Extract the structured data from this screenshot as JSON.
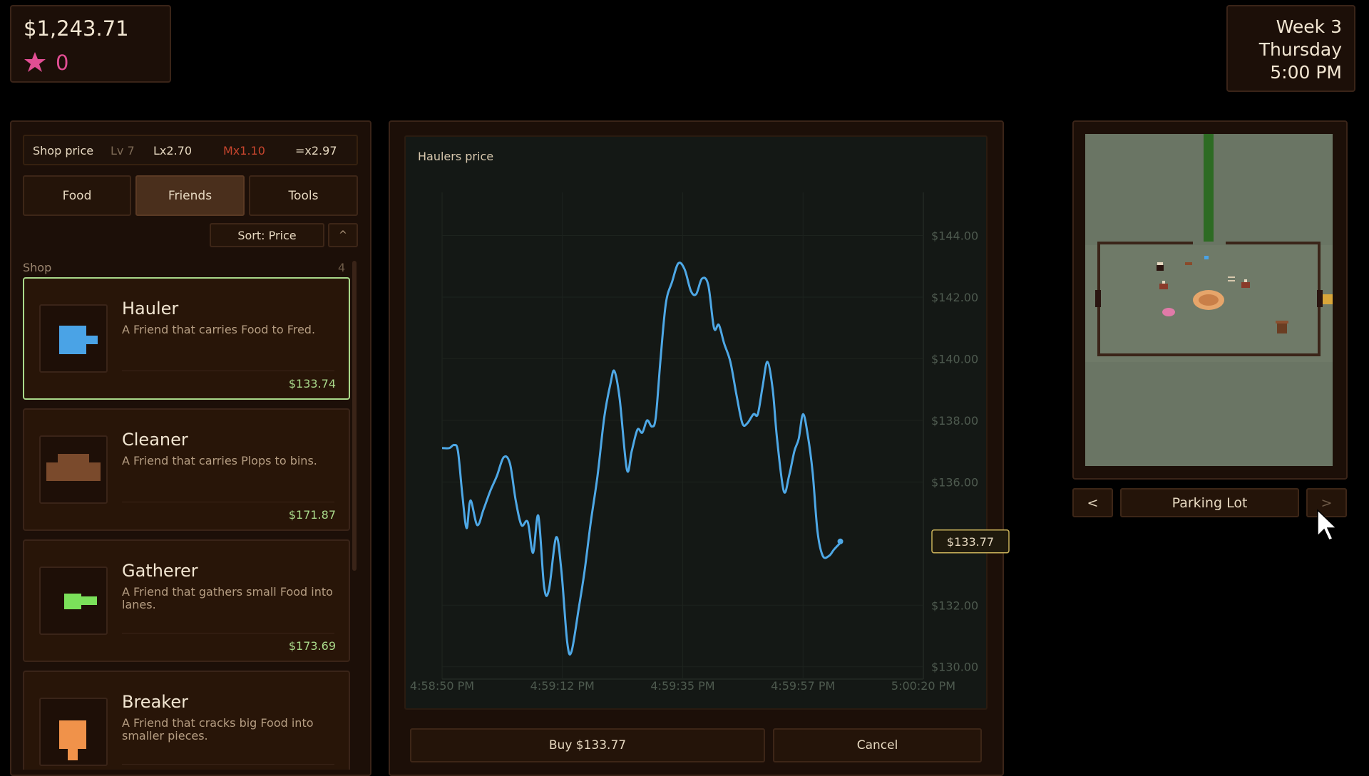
{
  "hud": {
    "money": "$1,243.71",
    "stars": "0"
  },
  "date": {
    "week": "Week 3",
    "day": "Thursday",
    "time": "5:00 PM"
  },
  "shop": {
    "price_row": {
      "label": "Shop price",
      "level": "Lv 7",
      "lx": "Lx2.70",
      "mx": "Mx1.10",
      "total": "=x2.97"
    },
    "tabs": [
      {
        "label": "Food"
      },
      {
        "label": "Friends"
      },
      {
        "label": "Tools"
      }
    ],
    "sort_label": "Sort: Price",
    "sort_dir": "^",
    "section_label": "Shop",
    "section_count": "4",
    "items": [
      {
        "name": "Hauler",
        "desc": "A Friend that carries Food to Fred.",
        "price": "$133.74",
        "icon_color": "#4aa3e6"
      },
      {
        "name": "Cleaner",
        "desc": "A Friend that carries Plops to bins.",
        "price": "$171.87",
        "icon_color": "#7a4a2c"
      },
      {
        "name": "Gatherer",
        "desc": "A Friend that gathers small Food into lanes.",
        "price": "$173.69",
        "icon_color": "#7be05a"
      },
      {
        "name": "Breaker",
        "desc": "A Friend that cracks big Food into smaller pieces.",
        "price": "",
        "icon_color": "#f0924a"
      }
    ]
  },
  "chart_title": "Haulers price",
  "buttons": {
    "buy": "Buy $133.77",
    "cancel": "Cancel"
  },
  "map": {
    "location": "Parking Lot",
    "prev": "<",
    "next": ">"
  },
  "chart_data": {
    "type": "line",
    "title": "Haulers price",
    "x_ticks": [
      "4:58:50 PM",
      "4:59:12 PM",
      "4:59:35 PM",
      "4:59:57 PM",
      "5:00:20 PM"
    ],
    "y_ticks": [
      "$144.00",
      "$142.00",
      "$140.00",
      "$138.00",
      "$136.00",
      "$132.00",
      "$130.00"
    ],
    "ylim": [
      129.6,
      145.4
    ],
    "current_label": "$133.77",
    "series": [
      {
        "color": "#4ea8e6",
        "values": [
          [
            0,
            137.1
          ],
          [
            1.5,
            137.1
          ],
          [
            2.5,
            137.2
          ],
          [
            3.3,
            137.0
          ],
          [
            4.2,
            135.6
          ],
          [
            5.1,
            134.5
          ],
          [
            5.9,
            135.4
          ],
          [
            7.3,
            134.6
          ],
          [
            8.6,
            135.1
          ],
          [
            10.0,
            135.7
          ],
          [
            11.4,
            136.2
          ],
          [
            12.8,
            136.8
          ],
          [
            14.1,
            136.6
          ],
          [
            15.3,
            135.4
          ],
          [
            16.5,
            134.6
          ],
          [
            17.8,
            134.7
          ],
          [
            18.9,
            133.7
          ],
          [
            20.0,
            134.9
          ],
          [
            21.2,
            132.6
          ],
          [
            22.2,
            132.5
          ],
          [
            23.7,
            134.2
          ],
          [
            24.8,
            133.1
          ],
          [
            26.0,
            130.8
          ],
          [
            26.9,
            130.5
          ],
          [
            28.4,
            131.9
          ],
          [
            29.6,
            133.1
          ],
          [
            30.9,
            134.7
          ],
          [
            32.3,
            136.2
          ],
          [
            33.7,
            138.1
          ],
          [
            35.0,
            139.2
          ],
          [
            35.8,
            139.6
          ],
          [
            36.9,
            138.7
          ],
          [
            38.4,
            136.4
          ],
          [
            39.4,
            137.0
          ],
          [
            40.6,
            137.7
          ],
          [
            41.6,
            137.6
          ],
          [
            42.6,
            138.0
          ],
          [
            43.6,
            137.8
          ],
          [
            44.4,
            138.1
          ],
          [
            45.4,
            140.0
          ],
          [
            46.5,
            141.8
          ],
          [
            47.8,
            142.5
          ],
          [
            49.1,
            143.1
          ],
          [
            50.4,
            142.9
          ],
          [
            51.7,
            142.2
          ],
          [
            52.8,
            142.1
          ],
          [
            54.0,
            142.6
          ],
          [
            55.3,
            142.4
          ],
          [
            56.5,
            141.0
          ],
          [
            57.5,
            141.1
          ],
          [
            58.6,
            140.5
          ],
          [
            59.9,
            139.9
          ],
          [
            61.2,
            138.8
          ],
          [
            62.4,
            137.9
          ],
          [
            63.4,
            137.9
          ],
          [
            64.7,
            138.2
          ],
          [
            65.6,
            138.2
          ],
          [
            66.6,
            139.1
          ],
          [
            67.6,
            139.9
          ],
          [
            68.7,
            139.0
          ],
          [
            69.6,
            137.4
          ],
          [
            71.0,
            135.7
          ],
          [
            72.1,
            136.2
          ],
          [
            73.2,
            137.0
          ],
          [
            74.1,
            137.4
          ],
          [
            75.0,
            138.2
          ],
          [
            76.0,
            137.5
          ],
          [
            77.0,
            136.3
          ],
          [
            78.0,
            134.4
          ],
          [
            79.1,
            133.6
          ],
          [
            80.4,
            133.6
          ],
          [
            81.4,
            133.8
          ],
          [
            82.6,
            134.0
          ]
        ]
      }
    ]
  }
}
